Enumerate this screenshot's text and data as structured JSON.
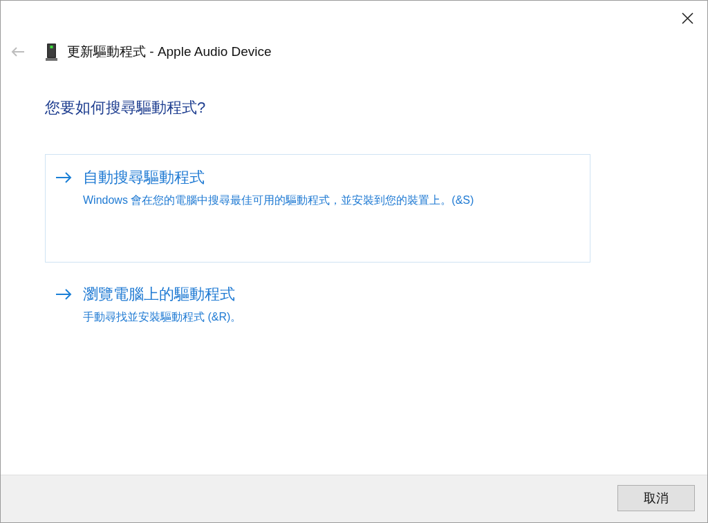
{
  "header": {
    "back_button": {
      "disabled": true
    },
    "title": "更新驅動程式 - Apple Audio Device"
  },
  "heading": "您要如何搜尋驅動程式?",
  "options": [
    {
      "title": "自動搜尋驅動程式",
      "description": "Windows 會在您的電腦中搜尋最佳可用的驅動程式，並安裝到您的裝置上。(&S)",
      "highlighted": true
    },
    {
      "title": "瀏覽電腦上的驅動程式",
      "description": "手動尋找並安裝驅動程式 (&R)。",
      "highlighted": false
    }
  ],
  "buttons": [
    {
      "label": "取消"
    }
  ]
}
